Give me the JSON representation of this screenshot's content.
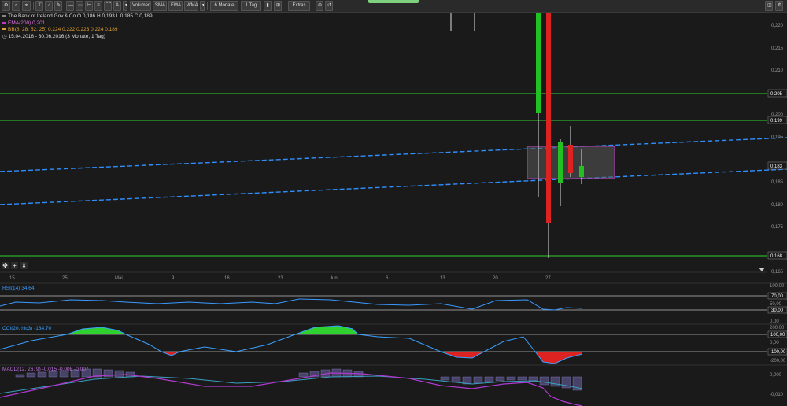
{
  "toolbar": {
    "buttons": [
      "Volumen",
      "SMA",
      "EMA",
      "WMA",
      "6 Monate",
      "1 Tag",
      "Extras"
    ]
  },
  "legend": {
    "security": "The Bank of Ireland Gov.&.Co  O 0,186  H 0,193  L 0,185  C 0,189",
    "ema": "EMA(200)  0,201",
    "bb": "BB(8; 28; 52; 25)  0,224  0,222  0,223  0,224  0,189",
    "range": "15.04.2016 - 30.06.2016 (3 Monate, 1 Tag)"
  },
  "colors": {
    "up": "#22c022",
    "down": "#dd2222",
    "hline": "#2ed12e",
    "trend": "#2f8fff",
    "box": "#c03ac0",
    "rsi": "#3a9aff",
    "cci": "#3aa0ff",
    "macd": "#b03ad0",
    "signal": "#3aa0c0"
  },
  "price_axis": {
    "ticks": [
      "0,220",
      "0,215",
      "0,210",
      "0,205",
      "0,200",
      "0,195",
      "0,190",
      "0,185",
      "0,180",
      "0,175",
      "0,170",
      "0,165"
    ],
    "badges": [
      "0,205",
      "0,199",
      "0,183",
      "0,168"
    ]
  },
  "dates": [
    "15",
    "25",
    "Mai",
    "9",
    "16",
    "23",
    "Jun",
    "6",
    "13",
    "20",
    "27"
  ],
  "rsi": {
    "label": "RSI(14)  34,64",
    "ticks": [
      "100,00",
      "70,00",
      "50,00",
      "30,00",
      "0,00"
    ]
  },
  "cci": {
    "label": "CCI(20, hlc3)  -134,70",
    "ticks": [
      "200,00",
      "100,00",
      "0,00",
      "-100,00",
      "-200,00"
    ]
  },
  "macd": {
    "label": "MACD(12, 26, 9)  -0,015  -0,008  -0,007",
    "ticks": [
      "0,000",
      "-0,010"
    ]
  }
}
